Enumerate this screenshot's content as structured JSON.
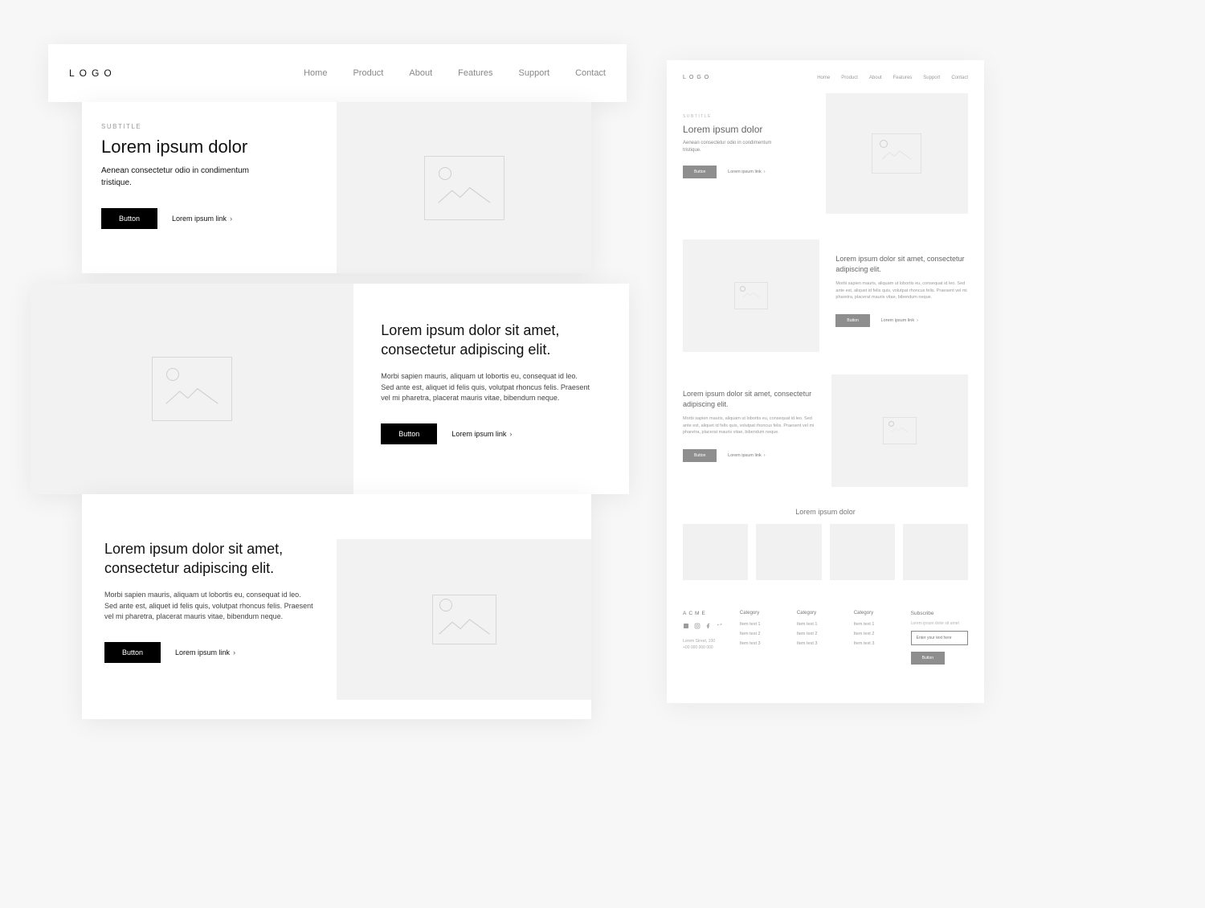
{
  "logo": "LOGO",
  "nav": [
    "Home",
    "Product",
    "About",
    "Features",
    "Support",
    "Contact"
  ],
  "hero": {
    "subtitle": "SUBTITLE",
    "title": "Lorem ipsum dolor",
    "body": "Aenean consectetur odio in condimentum tristique.",
    "button": "Button",
    "link": "Lorem ipsum link"
  },
  "section2": {
    "title": "Lorem ipsum dolor sit amet, consectetur adipiscing elit.",
    "body": "Morbi sapien mauris, aliquam ut lobortis eu, consequat id leo. Sed ante est, aliquet id felis quis, volutpat rhoncus felis. Praesent vel mi pharetra, placerat mauris vitae, bibendum neque.",
    "button": "Button",
    "link": "Lorem ipsum link"
  },
  "section3": {
    "title": "Lorem ipsum dolor sit amet, consectetur adipiscing elit.",
    "body": "Morbi sapien mauris, aliquam ut lobortis eu, consequat id leo. Sed ante est, aliquet id felis quis, volutpat rhoncus felis. Praesent vel mi pharetra, placerat mauris vitae, bibendum neque.",
    "button": "Button",
    "link": "Lorem ipsum link"
  },
  "mini": {
    "logo": "LOGO",
    "nav": [
      "Home",
      "Product",
      "About",
      "Features",
      "Support",
      "Contact"
    ],
    "hero": {
      "subtitle": "SUBTITLE",
      "title": "Lorem ipsum dolor",
      "body": "Aenean consectetur odio in condimentum tristique.",
      "button": "Button",
      "link": "Lorem ipsum link"
    },
    "sec_a": {
      "title": "Lorem ipsum dolor sit amet, consectetur adipiscing elit.",
      "body": "Morbi sapien mauris, aliquam ut lobortis eu, consequat id leo. Sed ante est, aliquet id felis quis, volutpat rhoncus felis. Praesent vel mi pharetra, placerat mauris vitae, bibendum neque.",
      "button": "Button",
      "link": "Lorem ipsum link"
    },
    "sec_b": {
      "title": "Lorem ipsum dolor sit amet, consectetur adipiscing elit.",
      "body": "Morbi sapien mauris, aliquam ut lobortis eu, consequat id leo. Sed ante est, aliquet id felis quis, volutpat rhoncus felis. Praesent vel mi pharetra, placerat mauris vitae, bibendum neque.",
      "button": "Button",
      "link": "Lorem ipsum link"
    },
    "grid_title": "Lorem ipsum dolor",
    "footer": {
      "brand": "ACME",
      "address_line1": "Lorem Street, 100",
      "address_line2": "+00 000 000 000",
      "cols": [
        {
          "heading": "Category",
          "items": [
            "Item text 1",
            "Item text 2",
            "Item text 3"
          ]
        },
        {
          "heading": "Category",
          "items": [
            "Item text 1",
            "Item text 2",
            "Item text 3"
          ]
        },
        {
          "heading": "Category",
          "items": [
            "Item text 1",
            "Item text 2",
            "Item text 3"
          ]
        }
      ],
      "subscribe": {
        "heading": "Subscribe",
        "hint": "Lorem ipsum dolor sit amet",
        "placeholder": "Enter your text here",
        "button": "Button"
      }
    }
  }
}
